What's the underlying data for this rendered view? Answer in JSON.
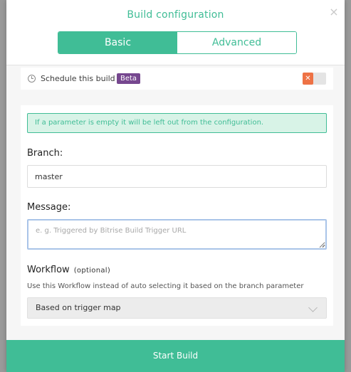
{
  "modal": {
    "title": "Build configuration",
    "close_glyph": "×"
  },
  "tabs": [
    {
      "label": "Basic",
      "active": true
    },
    {
      "label": "Advanced",
      "active": false
    }
  ],
  "schedule": {
    "icon": "clock-icon",
    "label": "Schedule this build",
    "badge": "Beta",
    "toggle_on": false,
    "toggle_glyph": "✕"
  },
  "params": {
    "info": "If a parameter is empty it will be left out from the configuration.",
    "branch": {
      "label": "Branch:",
      "value": "master"
    },
    "message": {
      "label": "Message:",
      "value": "",
      "placeholder": "e. g. Triggered by Bitrise Build Trigger URL"
    },
    "workflow": {
      "label": "Workflow",
      "optional": "(optional)",
      "help": "Use this Workflow instead of auto selecting it based on the branch parameter",
      "selected": "Based on trigger map"
    }
  },
  "footer": {
    "start_label": "Start Build"
  },
  "colors": {
    "accent": "#40bd96",
    "badge": "#76478f",
    "toggle_off": "#ee7245",
    "info_bg": "#d8f3e7"
  }
}
